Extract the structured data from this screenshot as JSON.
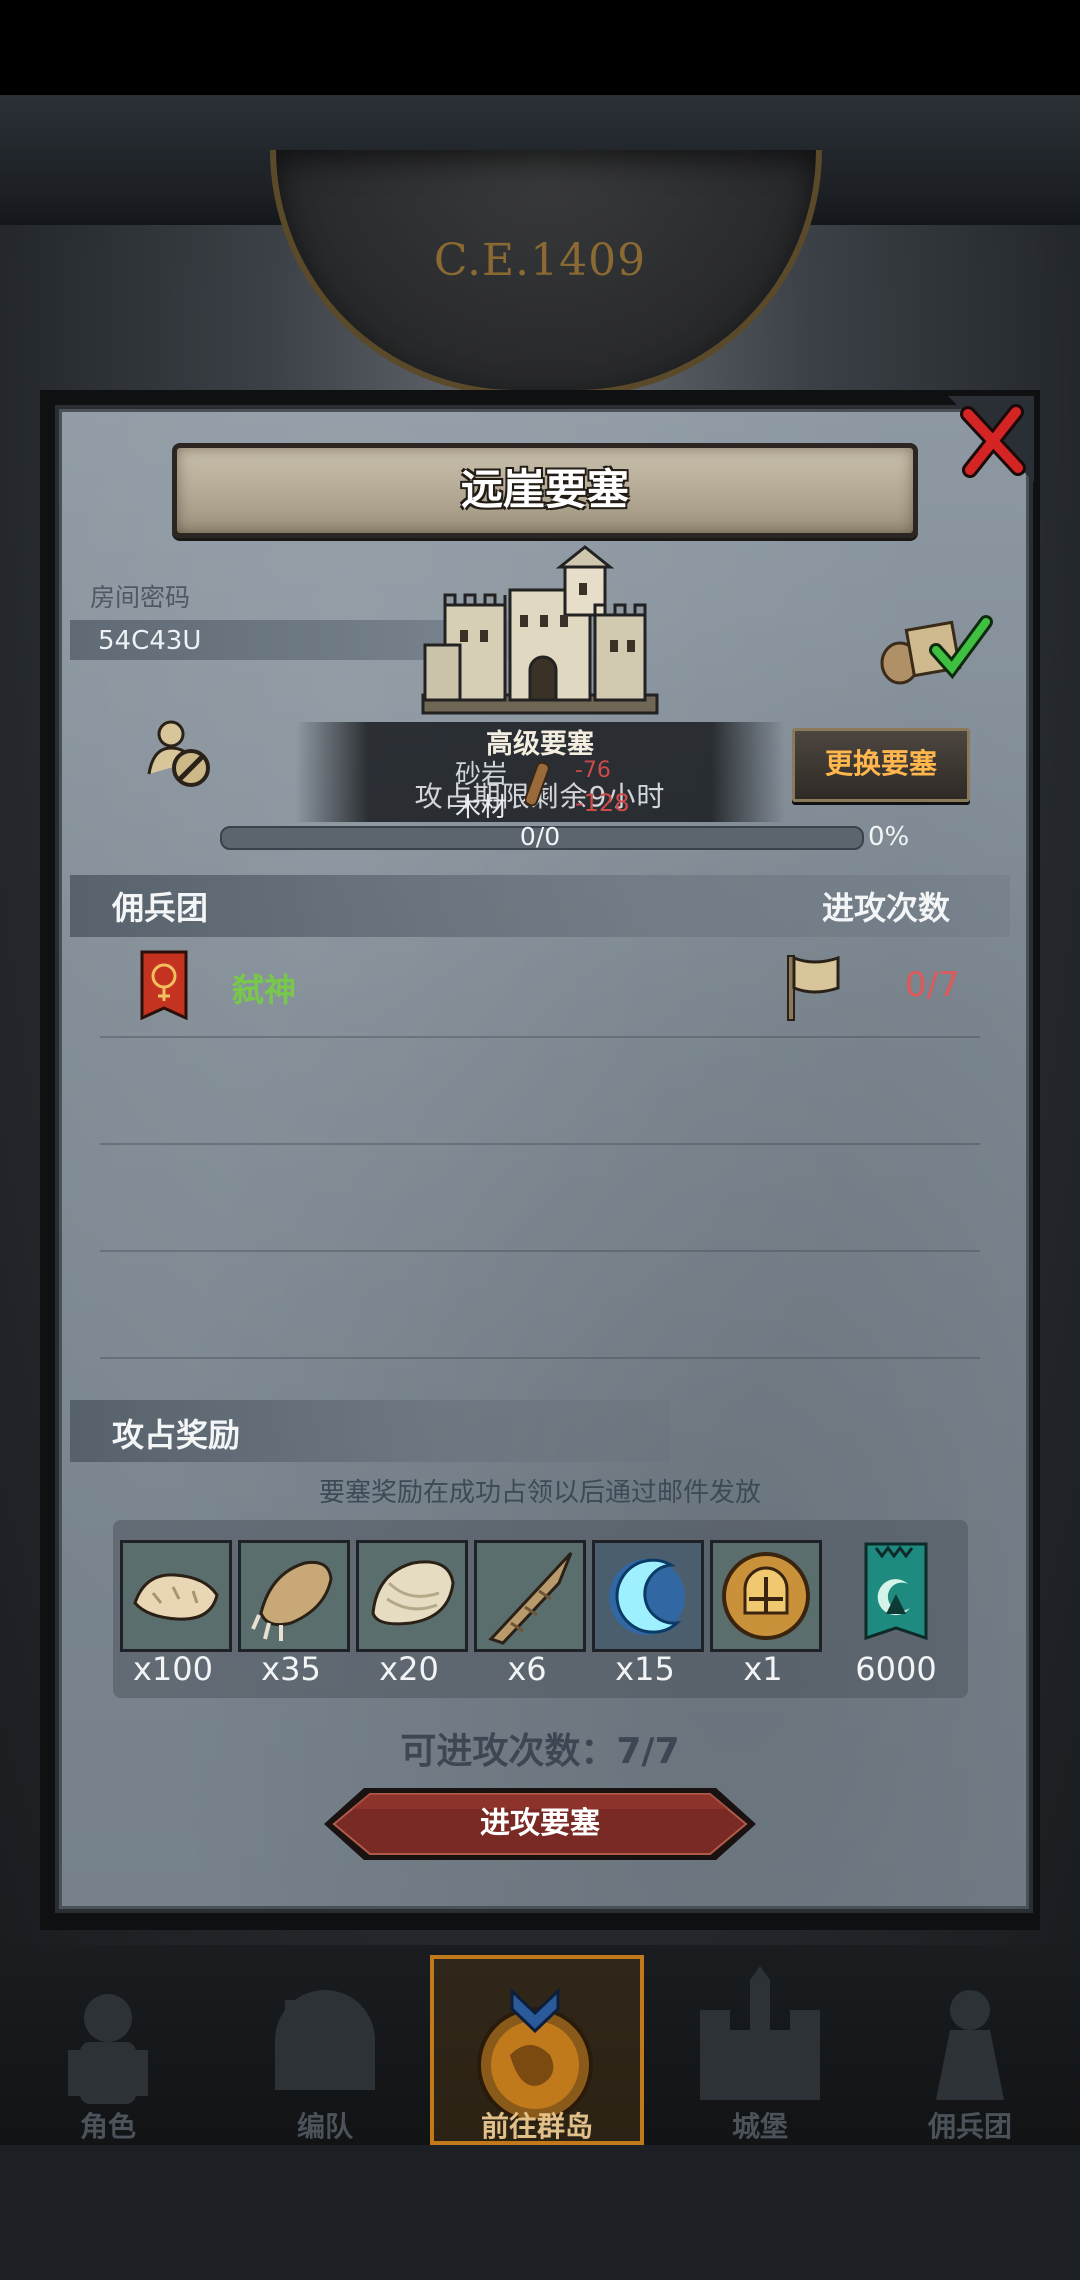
{
  "background": {
    "era": "C.E.1409"
  },
  "modal": {
    "title": "远崖要塞",
    "room_code_label": "房间密码",
    "room_code": "54C43U",
    "change_button": "更换要塞",
    "progress": "0/0",
    "progress_percent": "0%",
    "progress_fraction": 0
  },
  "tooltip": {
    "behind_text": "攻占期限剩余9小时",
    "title": "高级要塞",
    "rows": [
      {
        "label": "砂岩",
        "value": "-76"
      },
      {
        "label": "木材",
        "value": "-128"
      }
    ]
  },
  "mercenary": {
    "section_title": "佣兵团",
    "attacks_title": "进攻次数",
    "guild": {
      "name": "弑神",
      "attacks": "0/7"
    }
  },
  "rewards": {
    "section_title": "攻占奖励",
    "note": "要塞奖励在成功占领以后通过邮件发放",
    "items": [
      {
        "icon": "fur-pelt-icon",
        "qty": "x100"
      },
      {
        "icon": "beast-claw-icon",
        "qty": "x35"
      },
      {
        "icon": "scale-hide-icon",
        "qty": "x20"
      },
      {
        "icon": "horn-icon",
        "qty": "x6"
      },
      {
        "icon": "crescent-rune-icon",
        "qty": "x15"
      },
      {
        "icon": "golden-helmet-icon",
        "qty": "x1"
      },
      {
        "icon": "guild-banner-icon",
        "qty": "6000"
      }
    ]
  },
  "footer": {
    "attacks_left": "可进攻次数：7/7",
    "attack_button": "进攻要塞"
  },
  "nav": {
    "items": [
      {
        "label": "角色",
        "icon": "knight-icon"
      },
      {
        "label": "编队",
        "icon": "helmet-icon"
      },
      {
        "label": "前往群岛",
        "icon": "globe-icon"
      },
      {
        "label": "城堡",
        "icon": "castle-icon"
      },
      {
        "label": "佣兵团",
        "icon": "pawn-icon"
      }
    ],
    "active_index": 2
  },
  "colors": {
    "accent_orange": "#ffb64d",
    "guild_green": "#78c84b",
    "negative_red": "#d14a4a",
    "attack_button_red": "#7a2a25"
  }
}
